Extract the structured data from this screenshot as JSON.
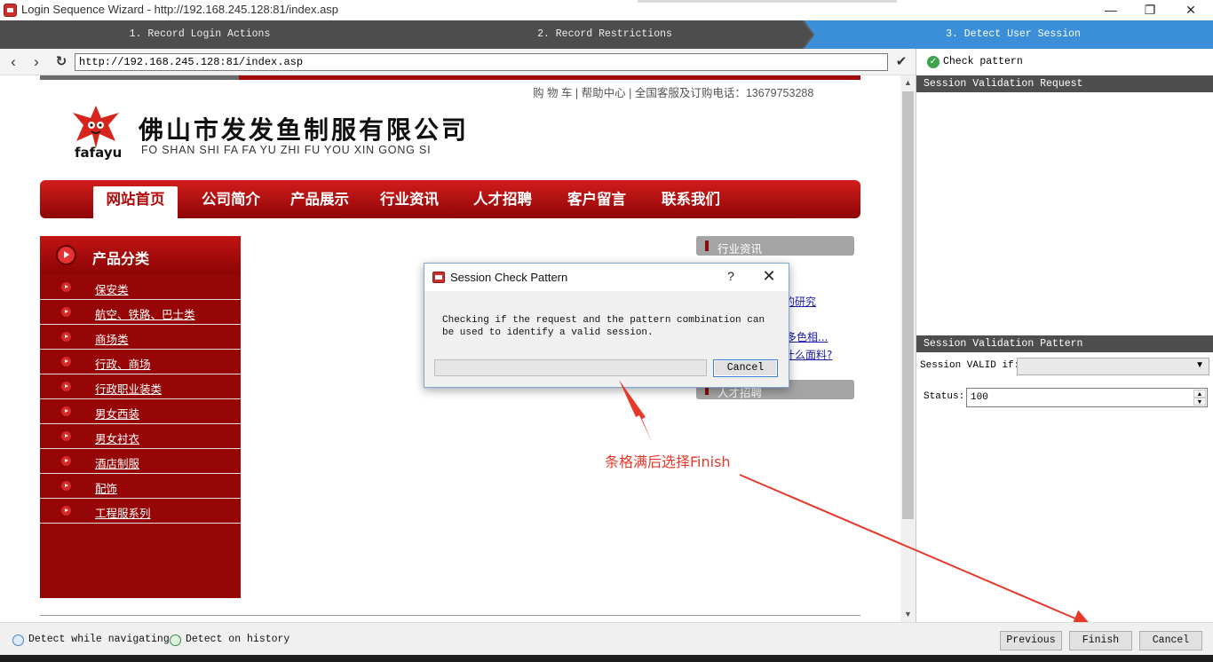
{
  "window": {
    "title": "Login Sequence Wizard - http://192.168.245.128:81/index.asp",
    "controls": {
      "minimize": "—",
      "restore": "❐",
      "close": "✕"
    }
  },
  "wizard_steps": [
    {
      "label": "1. Record Login Actions",
      "active": false
    },
    {
      "label": "2. Record Restrictions",
      "active": false
    },
    {
      "label": "3. Detect User Session",
      "active": true
    }
  ],
  "colors": {
    "step_bg": "#4d4d4d",
    "step_active": "#3a8fd8",
    "brand_red": "#a10d0d",
    "annotation": "#e6392a"
  },
  "browser": {
    "url": "http://192.168.245.128:81/index.asp",
    "back_icon": "chevron-left-icon",
    "forward_icon": "chevron-right-icon",
    "refresh_icon": "refresh-icon",
    "go_icon": "checkmark-icon"
  },
  "website": {
    "top_links": "购 物 车 | 帮助中心 | 全国客服及订购电话：13679753288",
    "brand_short": "fafayu",
    "company_name": "佛山市发发鱼制服有限公司",
    "company_pinyin": "FO SHAN SHI FA FA YU ZHI FU YOU XIN GONG SI",
    "nav": [
      "网站首页",
      "公司简介",
      "产品展示",
      "行业资讯",
      "人才招聘",
      "客户留言",
      "联系我们"
    ],
    "nav_active": "网站首页",
    "category_title": "产品分类",
    "categories": [
      "保安类",
      "航空、铁路、巴士类",
      "商场类",
      "行政、商场",
      "行政职业装类",
      "男女西装",
      "男女衬衣",
      "酒店制服",
      "配饰",
      "工程服系列"
    ],
    "news_title": "行业资讯",
    "news_links": [
      "的研究",
      "多色相...",
      "什么面料?"
    ],
    "jobs_title": "人才招聘"
  },
  "dialog": {
    "title": "Session Check Pattern",
    "help": "?",
    "close": "✕",
    "message": "Checking if the request and the pattern combination can be used to identify a valid session.",
    "progress": 0,
    "cancel_label": "Cancel"
  },
  "annotation": {
    "text": "条格满后选择Finish"
  },
  "right_panel": {
    "check_pattern_label": "Check pattern",
    "request_header": "Session Validation Request",
    "pattern_header": "Session Validation Pattern",
    "valid_if_label": "Session VALID if:",
    "valid_if_value": "",
    "status_label": "Status:",
    "status_value": "100"
  },
  "bottom": {
    "detect_navigating": "Detect while navigating",
    "detect_history": "Detect on history",
    "previous": "Previous",
    "finish": "Finish",
    "cancel": "Cancel"
  }
}
